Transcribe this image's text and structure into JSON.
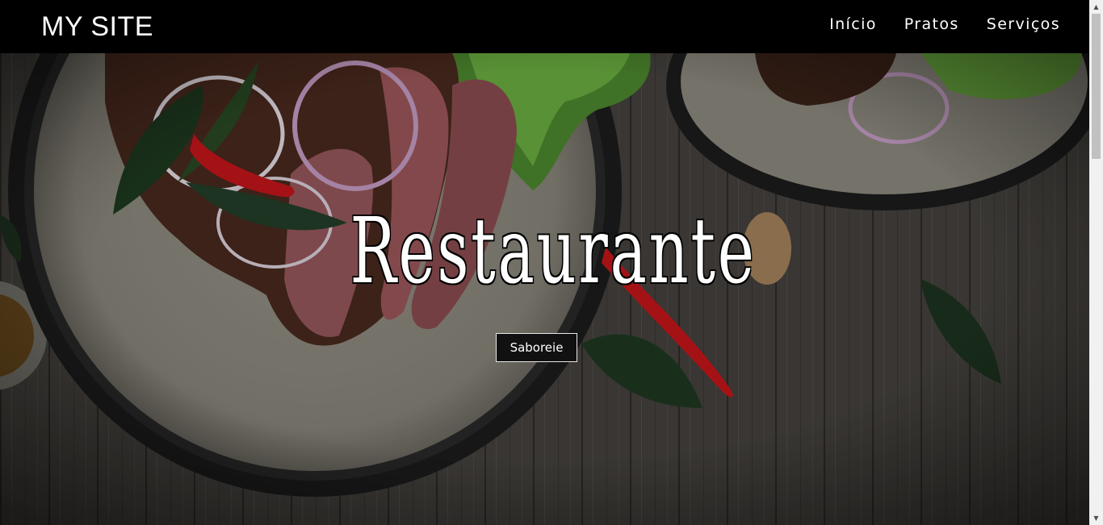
{
  "header": {
    "brand": "MY SITE",
    "nav": [
      "Início",
      "Pratos",
      "Serviços"
    ]
  },
  "hero": {
    "title": "Restaurante",
    "cta_label": "Saboreie"
  },
  "colors": {
    "header_bg": "#000000",
    "table_wood": "#4a4744",
    "plate_rim": "#1a1a1a",
    "plate_center": "#8c8a80",
    "chili": "#c8171c"
  },
  "icons": {
    "scroll_up": "arrow-up-icon",
    "scroll_down": "arrow-down-icon"
  }
}
